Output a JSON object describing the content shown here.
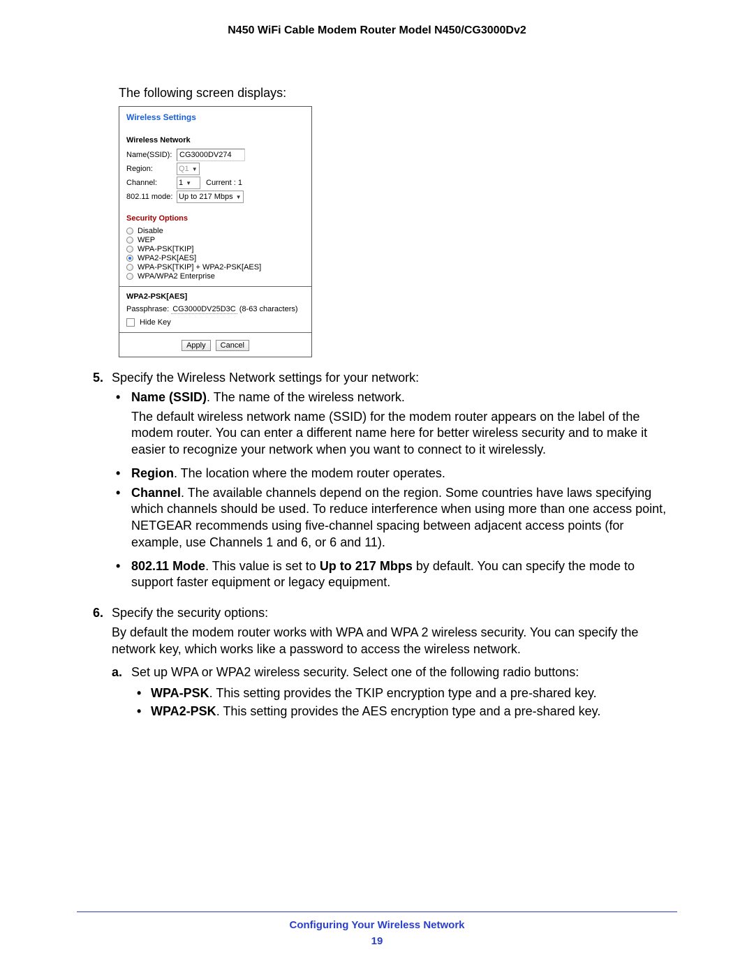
{
  "header": {
    "title": "N450 WiFi Cable Modem Router Model N450/CG3000Dv2"
  },
  "intro": "The following screen displays:",
  "screenshot": {
    "title": "Wireless Settings",
    "network": {
      "heading": "Wireless Network",
      "ssid_label": "Name(SSID):",
      "ssid_value": "CG3000DV274",
      "region_label": "Region:",
      "region_value": "Q1",
      "channel_label": "Channel:",
      "channel_value": "1",
      "channel_current": "Current : 1",
      "mode_label": "802.11 mode:",
      "mode_value": "Up to 217 Mbps"
    },
    "security": {
      "heading": "Security Options",
      "options": [
        {
          "label": "Disable",
          "selected": false
        },
        {
          "label": "WEP",
          "selected": false
        },
        {
          "label": "WPA-PSK[TKIP]",
          "selected": false
        },
        {
          "label": "WPA2-PSK[AES]",
          "selected": true
        },
        {
          "label": "WPA-PSK[TKIP] + WPA2-PSK[AES]",
          "selected": false
        },
        {
          "label": "WPA/WPA2 Enterprise",
          "selected": false
        }
      ]
    },
    "wpa2": {
      "heading": "WPA2-PSK[AES]",
      "pass_label": "Passphrase:",
      "pass_value": "CG3000DV25D3C",
      "pass_hint": "(8-63 characters)",
      "hide_key": "Hide Key"
    },
    "buttons": {
      "apply": "Apply",
      "cancel": "Cancel"
    }
  },
  "steps": {
    "s5": {
      "num": "5.",
      "lead": "Specify the Wireless Network settings for your network:",
      "ssid_bold": "Name (SSID)",
      "ssid_rest": ". The name of the wireless network.",
      "ssid_para": "The default wireless network name (SSID) for the modem router appears on the label of the modem router. You can enter a different name here for better wireless security and to make it easier to recognize your network when you want to connect to it wirelessly.",
      "region_bold": "Region",
      "region_rest": ". The location where the modem router operates.",
      "channel_bold": "Channel",
      "channel_rest": ". The available channels depend on the region. Some countries have laws specifying which channels should be used. To reduce interference when using more than one access point, NETGEAR recommends using five-channel spacing between adjacent access points (for example, use Channels 1 and 6, or 6 and 11).",
      "mode_bold": "802.11 Mode",
      "mode_mid1": ". This value is set to ",
      "mode_bold2": "Up to 217 Mbps",
      "mode_mid2": " by default. You can specify the mode to support faster equipment or legacy equipment."
    },
    "s6": {
      "num": "6.",
      "lead": "Specify the security options:",
      "para": "By default the modem router works with WPA and WPA 2 wireless security. You can specify the network key, which works like a password to access the wireless network.",
      "a_marker": "a.",
      "a_text": "Set up WPA or WPA2 wireless security. Select one of the following radio buttons:",
      "wpa_bold": "WPA-PSK",
      "wpa_rest": ". This setting provides the TKIP encryption type and a pre-shared key.",
      "wpa2_bold": "WPA2-PSK",
      "wpa2_rest": ". This setting provides the AES encryption type and a pre-shared key."
    }
  },
  "footer": {
    "section": "Configuring Your Wireless Network",
    "page": "19"
  }
}
